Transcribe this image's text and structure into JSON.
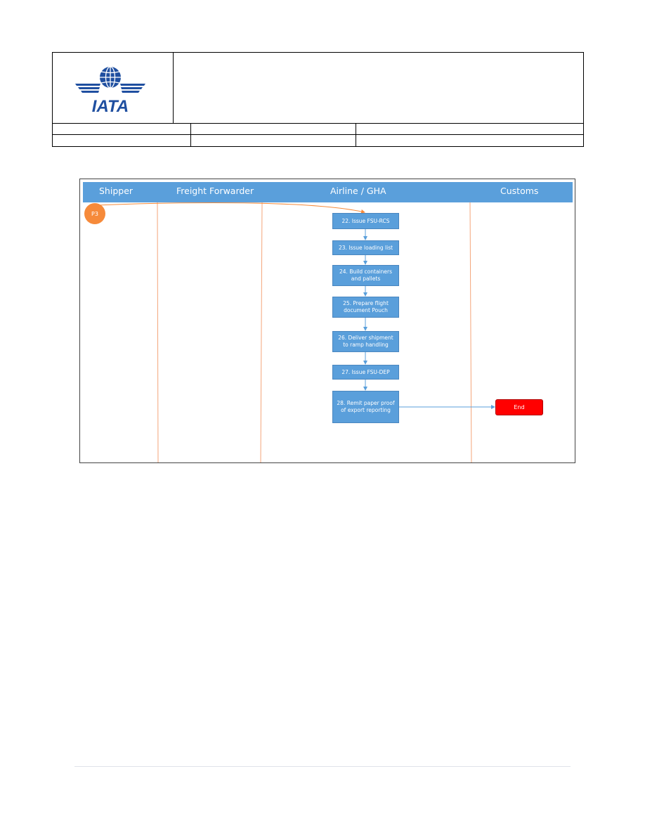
{
  "header": {
    "logo_text": "IATA",
    "title": "",
    "row1": [
      "",
      "",
      ""
    ],
    "row2": [
      "",
      "",
      ""
    ]
  },
  "diagram": {
    "lanes": [
      "Shipper",
      "Freight Forwarder",
      "Airline / GHA",
      "Customs"
    ],
    "start_connector": "P3",
    "steps": [
      "22. Issue FSU-RCS",
      "23. Issue loading list",
      "24. Build containers and pallets",
      "25. Prepare flight document Pouch",
      "26. Deliver shipment to ramp handling",
      "27. Issue FSU-DEP",
      "28. Remit paper proof of export reporting"
    ],
    "end_label": "End",
    "colors": {
      "lane_bar": "#5a9fdb",
      "step_fill": "#5a9fdb",
      "lane_divider": "#f4a57a",
      "start_connector": "#f68a3a",
      "end_fill": "#ff0000",
      "arrow": "#5a9fdb",
      "connector_line": "#f68a3a"
    }
  }
}
